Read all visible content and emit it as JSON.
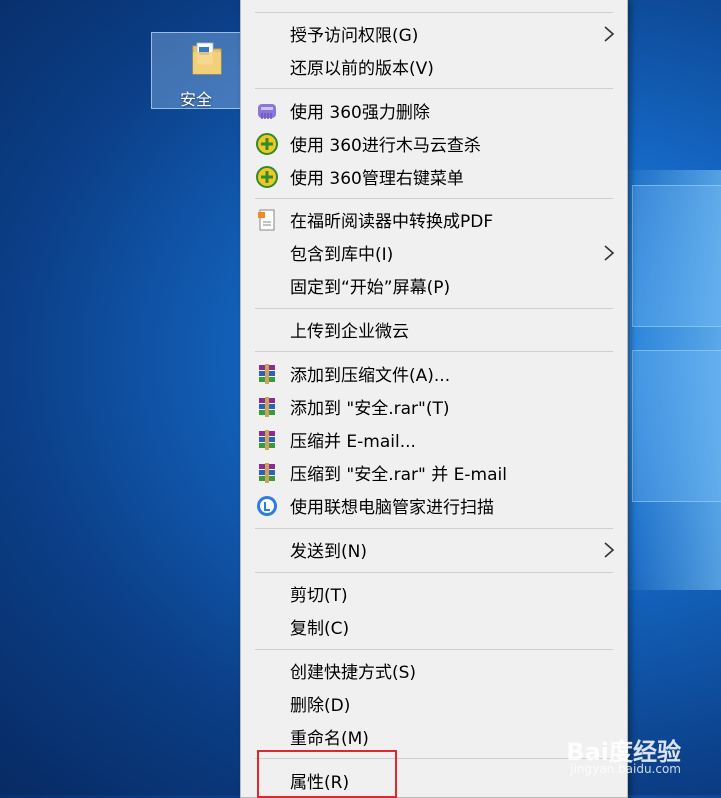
{
  "desktop": {
    "icon_label": "安全"
  },
  "menu": {
    "items": [
      {
        "label": "授予访问权限(G)"
      },
      {
        "label": "还原以前的版本(V)"
      },
      {
        "label": "使用 360强力删除"
      },
      {
        "label": "使用 360进行木马云查杀"
      },
      {
        "label": "使用 360管理右键菜单"
      },
      {
        "label": "在福昕阅读器中转换成PDF"
      },
      {
        "label": "包含到库中(I)"
      },
      {
        "label": "固定到“开始”屏幕(P)"
      },
      {
        "label": "上传到企业微云"
      },
      {
        "label": "添加到压缩文件(A)..."
      },
      {
        "label": "添加到 \"安全.rar\"(T)"
      },
      {
        "label": "压缩并 E-mail..."
      },
      {
        "label": "压缩到 \"安全.rar\" 并 E-mail"
      },
      {
        "label": "使用联想电脑管家进行扫描"
      },
      {
        "label": "发送到(N)"
      },
      {
        "label": "剪切(T)"
      },
      {
        "label": "复制(C)"
      },
      {
        "label": "创建快捷方式(S)"
      },
      {
        "label": "删除(D)"
      },
      {
        "label": "重命名(M)"
      },
      {
        "label": "属性(R)"
      }
    ]
  },
  "watermark": {
    "brand": "Bai度经验",
    "url": "jingyan.baidu.com"
  },
  "colors": {
    "desktop_accent": "#1466c2",
    "menu_bg": "#f0f0f0",
    "highlight_border": "#e0272b"
  }
}
